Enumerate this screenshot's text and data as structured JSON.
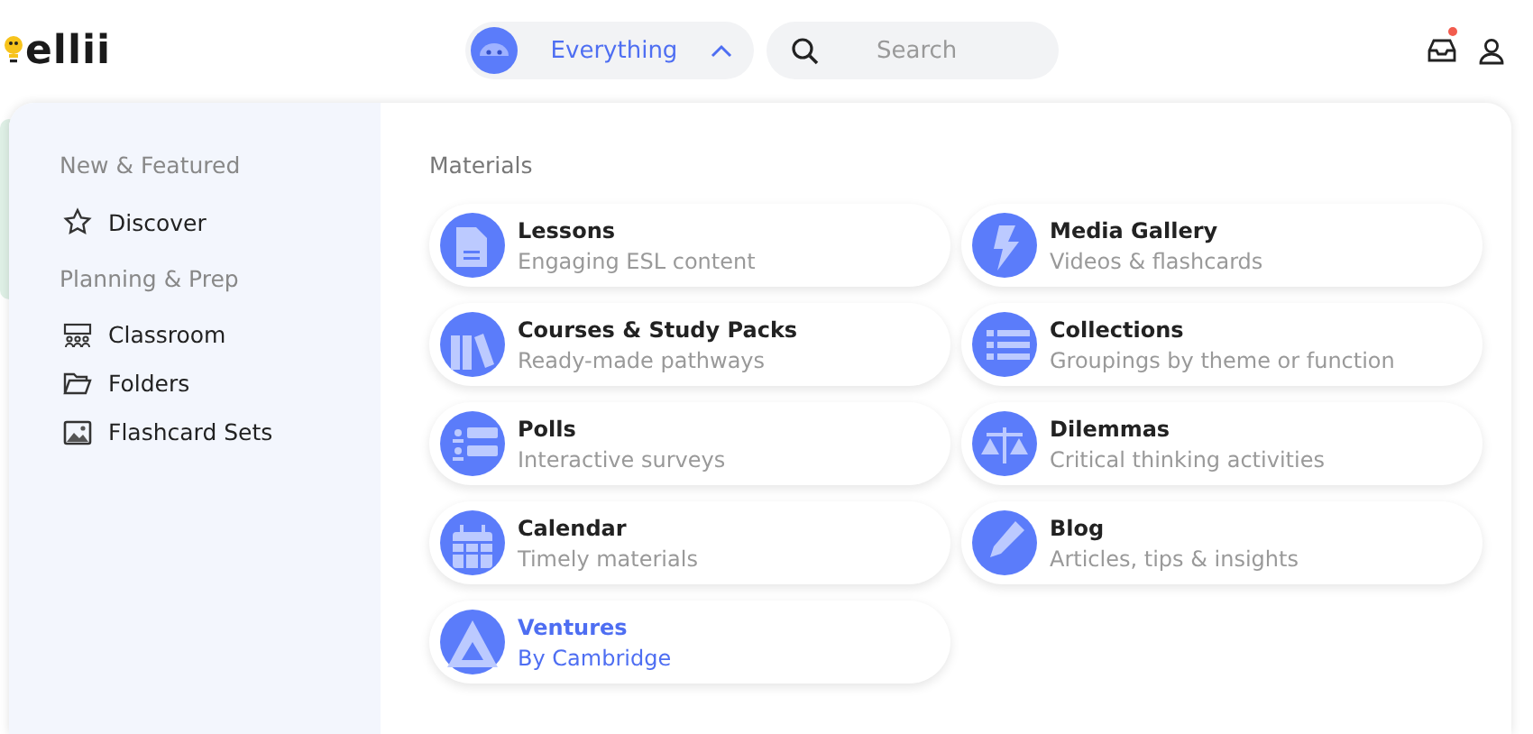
{
  "header": {
    "logo": "ellii",
    "scope_selector": {
      "label": "Everything",
      "expanded": true
    },
    "search": {
      "placeholder": "Search"
    },
    "inbox": {
      "unread": true
    }
  },
  "sidebar": {
    "sections": [
      {
        "heading": "New & Featured",
        "items": [
          "Discover"
        ]
      },
      {
        "heading": "Planning & Prep",
        "items": [
          "Classroom",
          "Folders",
          "Flashcard Sets"
        ]
      }
    ]
  },
  "materials": {
    "heading": "Materials",
    "items": [
      {
        "title": "Lessons",
        "subtitle": "Engaging ESL content",
        "highlighted": false
      },
      {
        "title": "Media Gallery",
        "subtitle": "Videos & flashcards",
        "highlighted": false
      },
      {
        "title": "Courses & Study Packs",
        "subtitle": "Ready-made pathways",
        "highlighted": false
      },
      {
        "title": "Collections",
        "subtitle": "Groupings by theme or function",
        "highlighted": false
      },
      {
        "title": "Polls",
        "subtitle": "Interactive surveys",
        "highlighted": false
      },
      {
        "title": "Dilemmas",
        "subtitle": "Critical thinking activities",
        "highlighted": false
      },
      {
        "title": "Calendar",
        "subtitle": "Timely materials",
        "highlighted": false
      },
      {
        "title": "Blog",
        "subtitle": "Articles, tips & insights",
        "highlighted": false
      },
      {
        "title": "Ventures",
        "subtitle": "By Cambridge",
        "highlighted": true
      }
    ]
  }
}
